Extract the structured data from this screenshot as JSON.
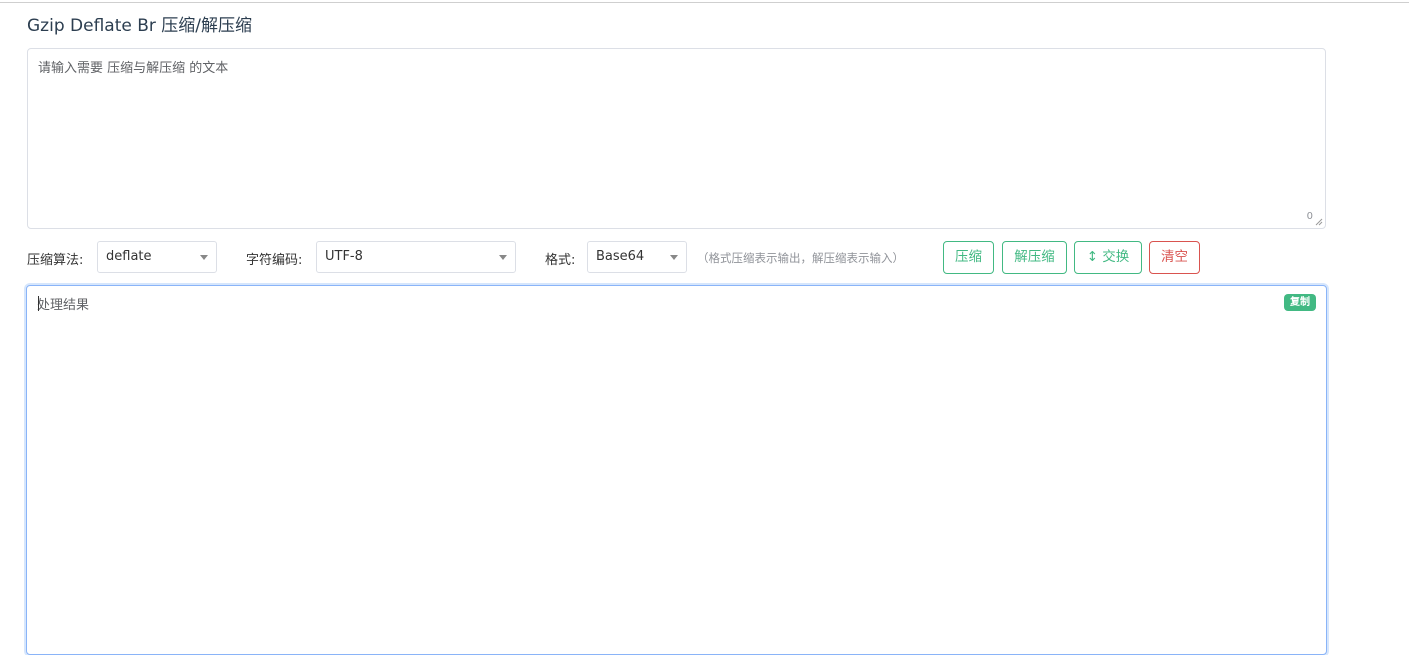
{
  "page": {
    "title": "Gzip Deflate Br 压缩/解压缩"
  },
  "input": {
    "placeholder": "请输入需要 压缩与解压缩 的文本",
    "value": "",
    "count": "0"
  },
  "options": {
    "algorithm": {
      "label": "压缩算法:",
      "value": "deflate"
    },
    "encoding": {
      "label": "字符编码:",
      "value": "UTF-8"
    },
    "format": {
      "label": "格式:",
      "value": "Base64"
    },
    "hint": "（格式压缩表示输出，解压缩表示输入）"
  },
  "buttons": {
    "compress": "压缩",
    "decompress": "解压缩",
    "swap_icon": "↕",
    "swap": "交换",
    "clear": "清空"
  },
  "output": {
    "placeholder": "处理结果",
    "value": "",
    "copy": "复制"
  },
  "colors": {
    "accent": "#42b983",
    "danger": "#d9534f",
    "focus": "#8ab4f8"
  }
}
